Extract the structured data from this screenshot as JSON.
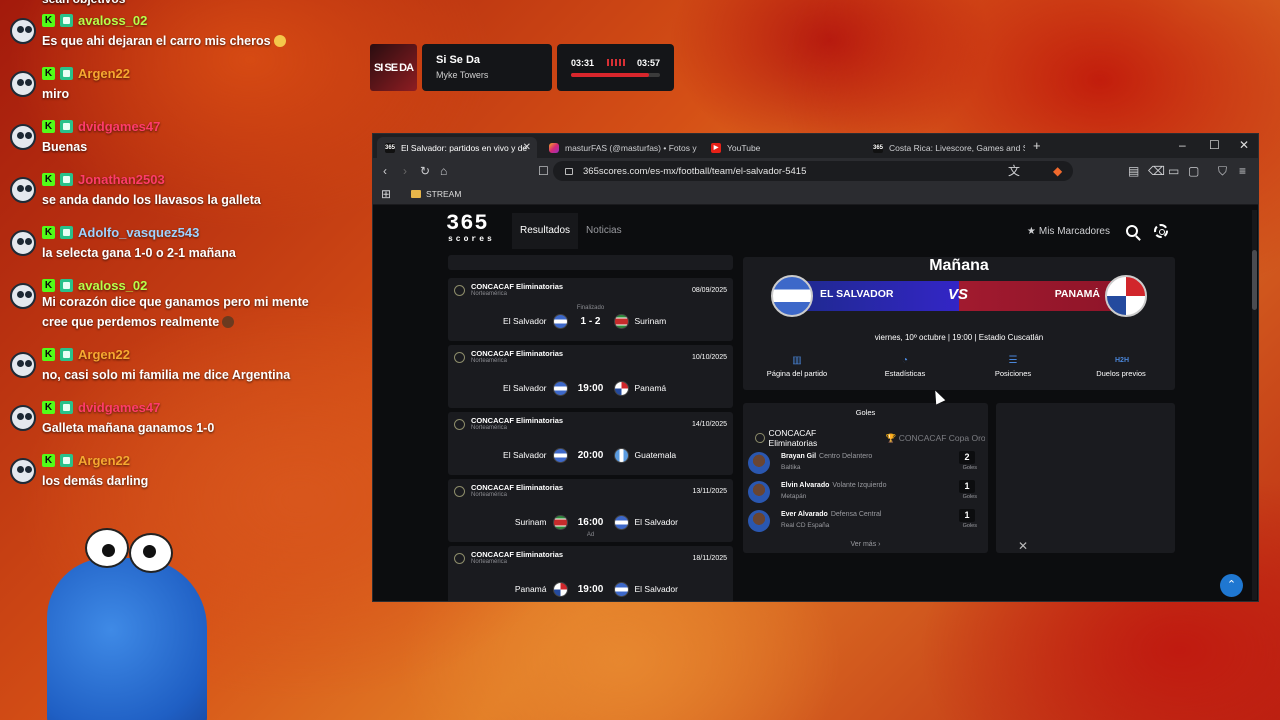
{
  "chat": {
    "top_text": "sean objetivos",
    "messages": [
      {
        "user": "avaloss_02",
        "color": "#b8ff4a",
        "text": "Es que ahi dejaran el carro mis cheros"
      },
      {
        "user": "Argen22",
        "color": "#f6a830",
        "text": "miro"
      },
      {
        "user": "dvidgames47",
        "color": "#ff3b6a",
        "text": "Buenas"
      },
      {
        "user": "Jonathan2503",
        "color": "#ff3b6a",
        "text": "se anda dando los llavasos la galleta"
      },
      {
        "user": "Adolfo_vasquez543",
        "color": "#9fd3ff",
        "text": "la selecta gana 1-0 o 2-1 mañana"
      },
      {
        "user": "avaloss_02",
        "color": "#b8ff4a",
        "text": "Mi corazón dice que ganamos pero mi mente",
        "text2": "cree que perdemos realmente"
      },
      {
        "user": "Argen22",
        "color": "#f6a830",
        "text": "no, casi solo mi familia me dice Argentina"
      },
      {
        "user": "dvidgames47",
        "color": "#ff3b6a",
        "text": "Galleta mañana ganamos 1-0"
      },
      {
        "user": "Argen22",
        "color": "#f6a830",
        "text": "los demás darling"
      }
    ]
  },
  "now_playing": {
    "art_text": "SI SE DA",
    "title": "Si Se Da",
    "artist": "Myke Towers",
    "elapsed": "03:31",
    "duration": "03:57",
    "progress": 0.88
  },
  "browser": {
    "tabs": [
      {
        "label": "El Salvador: partidos en vivo y de",
        "icon": "365",
        "active": true
      },
      {
        "label": "masturFAS (@masturfas) • Fotos y vid",
        "icon": "instagram"
      },
      {
        "label": "YouTube",
        "icon": "youtube"
      },
      {
        "label": "Costa Rica: Livescore, Games and Sch",
        "icon": "365"
      }
    ],
    "url": "365scores.com/es-mx/football/team/el-salvador-5415",
    "bookmark": "STREAM"
  },
  "site": {
    "logo_num": "365",
    "logo_word": "scores",
    "nav": [
      "Resultados",
      "Noticias"
    ],
    "my_scores": "Mis Marcadores"
  },
  "matches": [
    {
      "comp": "CONCACAF Eliminatorias",
      "region": "Norteamérica",
      "date": "08/09/2025",
      "status": "Finalizado",
      "home": "El Salvador",
      "home_flag": "sv",
      "score": "1 - 2",
      "away": "Surinam",
      "away_flag": "sr"
    },
    {
      "comp": "CONCACAF Eliminatorias",
      "region": "Norteamérica",
      "date": "10/10/2025",
      "status": "",
      "home": "El Salvador",
      "home_flag": "sv",
      "score": "19:00",
      "away": "Panamá",
      "away_flag": "pa"
    },
    {
      "comp": "CONCACAF Eliminatorias",
      "region": "Norteamérica",
      "date": "14/10/2025",
      "status": "",
      "home": "El Salvador",
      "home_flag": "sv",
      "score": "20:00",
      "away": "Guatemala",
      "away_flag": "gt"
    },
    {
      "comp": "CONCACAF Eliminatorias",
      "region": "Norteamérica",
      "date": "13/11/2025",
      "status": "",
      "home": "Surinam",
      "home_flag": "sr",
      "score": "16:00",
      "away": "El Salvador",
      "away_flag": "sv",
      "ad": "Ad"
    },
    {
      "comp": "CONCACAF Eliminatorias",
      "region": "Norteamérica",
      "date": "18/11/2025",
      "status": "",
      "home": "Panamá",
      "home_flag": "pa",
      "score": "19:00",
      "away": "El Salvador",
      "away_flag": "sv"
    }
  ],
  "hero": {
    "title": "Mañana",
    "home": "EL SALVADOR",
    "vs": "VS",
    "away": "PANAMÁ",
    "info": "viernes, 10º octubre | 19:00 | Estadio Cuscatlán",
    "links": [
      "Página del partido",
      "Estadísticas",
      "Posiciones",
      "Duelos previos"
    ],
    "h2h": "H2H"
  },
  "goals": {
    "title": "Goles",
    "tab1": "CONCACAF Eliminatorias",
    "tab2": "CONCACAF Copa Oro",
    "players": [
      {
        "name": "Brayan Gil",
        "pos": "Centro Delantero",
        "club": "Baltika",
        "goals": "2",
        "label": "Goles"
      },
      {
        "name": "Elvin Alvarado",
        "pos": "Volante Izquierdo",
        "club": "Metapán",
        "goals": "1",
        "label": "Goles"
      },
      {
        "name": "Ever Alvarado",
        "pos": "Defensa Central",
        "club": "Real CD España",
        "goals": "1",
        "label": "Goles"
      }
    ],
    "more": "Ver más"
  }
}
